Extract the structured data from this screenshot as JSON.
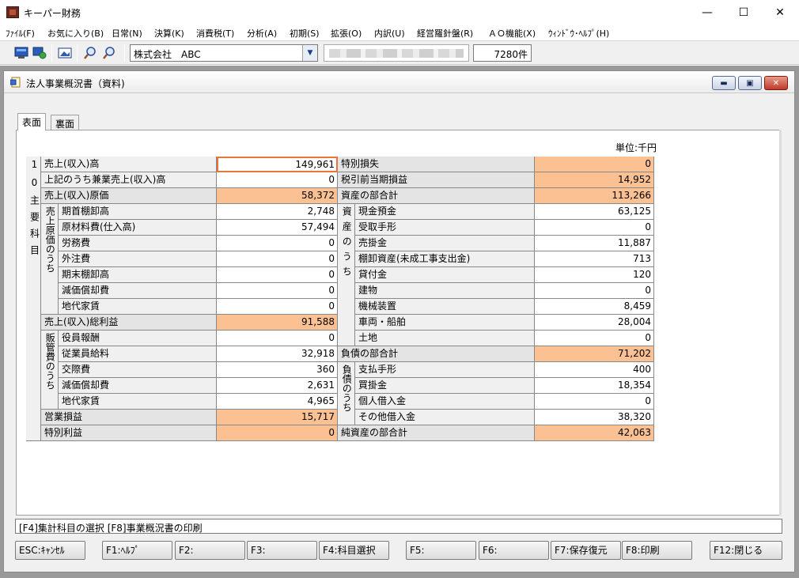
{
  "app": {
    "title": "キーパー財務",
    "minimize": "—",
    "maximize": "☐",
    "close": "✕"
  },
  "menu": [
    "ﾌｧｲﾙ(F)",
    "お気に入り(B)",
    "日常(N)",
    "決算(K)",
    "消費税(T)",
    "分析(A)",
    "初期(S)",
    "拡張(O)",
    "内訳(U)",
    "経営羅針盤(R)",
    "ＡＯ機能(X)",
    "ｳｨﾝﾄﾞｳ･ﾍﾙﾌﾟ(H)"
  ],
  "toolbar": {
    "company": "株式会社　ABC",
    "record_count": "7280件"
  },
  "window": {
    "title": "法人事業概況書（資料)",
    "tabs": [
      "表面",
      "裏面"
    ],
    "unit": "単位:千円"
  },
  "side_labels": {
    "main_items": "10主要科目",
    "cost_of_sales": "売上原価のうち",
    "sga": "販管費のうち",
    "assets": "資産のうち",
    "liabilities": "負債のうち"
  },
  "left_rows": [
    {
      "label": "売上(収入)高",
      "value": "149,961"
    },
    {
      "label": "上記のうち兼業売上(収入)高",
      "value": "0"
    },
    {
      "label": "売上(収入)原価",
      "value": "58,372"
    },
    {
      "label": "期首棚卸高",
      "value": "2,748"
    },
    {
      "label": "原材料費(仕入高)",
      "value": "57,494"
    },
    {
      "label": "労務費",
      "value": "0"
    },
    {
      "label": "外注費",
      "value": "0"
    },
    {
      "label": "期末棚卸高",
      "value": "0"
    },
    {
      "label": "減価償却費",
      "value": "0"
    },
    {
      "label": "地代家賃",
      "value": "0"
    },
    {
      "label": "売上(収入)総利益",
      "value": "91,588"
    },
    {
      "label": "役員報酬",
      "value": "0"
    },
    {
      "label": "従業員給料",
      "value": "32,918"
    },
    {
      "label": "交際費",
      "value": "360"
    },
    {
      "label": "減価償却費",
      "value": "2,631"
    },
    {
      "label": "地代家賃",
      "value": "4,965"
    },
    {
      "label": "営業損益",
      "value": "15,717"
    },
    {
      "label": "特別利益",
      "value": "0"
    }
  ],
  "right_rows": [
    {
      "label": "特別損失",
      "value": "0"
    },
    {
      "label": "税引前当期損益",
      "value": "14,952"
    },
    {
      "label": "資産の部合計",
      "value": "113,266"
    },
    {
      "label": "現金預金",
      "value": "63,125"
    },
    {
      "label": "受取手形",
      "value": "0"
    },
    {
      "label": "売掛金",
      "value": "11,887"
    },
    {
      "label": "棚卸資産(未成工事支出金)",
      "value": "713"
    },
    {
      "label": "貸付金",
      "value": "120"
    },
    {
      "label": "建物",
      "value": "0"
    },
    {
      "label": "機械装置",
      "value": "8,459"
    },
    {
      "label": "車両・船舶",
      "value": "28,004"
    },
    {
      "label": "土地",
      "value": "0"
    },
    {
      "label": "負債の部合計",
      "value": "71,202"
    },
    {
      "label": "支払手形",
      "value": "400"
    },
    {
      "label": "買掛金",
      "value": "18,354"
    },
    {
      "label": "個人借入金",
      "value": "0"
    },
    {
      "label": "その他借入金",
      "value": "38,320"
    },
    {
      "label": "純資産の部合計",
      "value": "42,063"
    }
  ],
  "highlight_color": "#fbc193",
  "selected_border_color": "#e8743b",
  "status_text": "[F4]集計科目の選択  [F8]事業概況書の印刷",
  "fkeys": [
    "ESC:ｷｬﾝｾﾙ",
    "F1:ﾍﾙﾌﾟ",
    "F2:",
    "F3:",
    "F4:科目選択",
    "F5:",
    "F6:",
    "F7:保存復元",
    "F8:印刷",
    "F12:閉じる"
  ]
}
